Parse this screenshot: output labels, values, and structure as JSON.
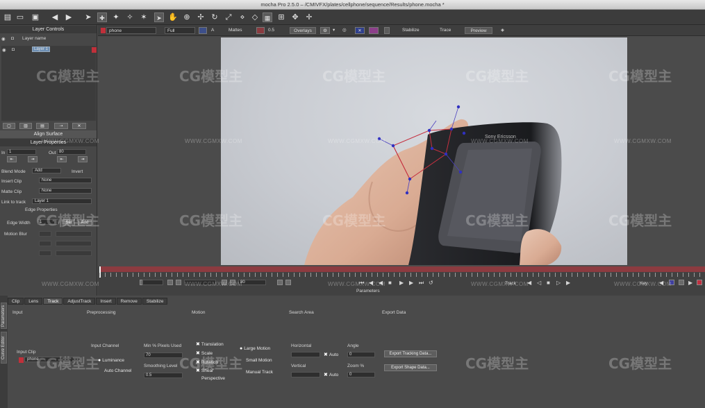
{
  "window": {
    "title": "mocha Pro 2.5.0 – /CMIVFX/plates/cellphone/sequence/Results/phone.mocha *"
  },
  "viewer_bar": {
    "layer_name": "phone",
    "view_mode": "Full",
    "mattes_label": "Mattes",
    "opacity_value": "0.5",
    "overlays_label": "Overlays",
    "stabilize_label": "Stabilize",
    "trace_label": "Trace",
    "preview_label": "Preview"
  },
  "layer_controls": {
    "title": "Layer Controls",
    "column_header": "Layer name",
    "layers": [
      {
        "name": "Layer 1"
      }
    ]
  },
  "align_surface_label": "Align Surface",
  "layer_properties": {
    "title": "Layer Properties",
    "in_label": "In",
    "in_value": "1",
    "out_label": "Out",
    "out_value": "80",
    "blend_mode_label": "Blend Mode",
    "blend_mode_value": "Add",
    "invert_label": "Invert",
    "insert_clip_label": "Insert Clip",
    "insert_clip_value": "None",
    "matte_clip_label": "Matte Clip",
    "matte_clip_value": "None",
    "link_to_track_label": "Link to track",
    "link_to_track_value": "Layer 1"
  },
  "edge_properties": {
    "title": "Edge Properties",
    "edge_width_label": "Edge Width",
    "edge_width_value": "1",
    "set_label": "Set",
    "add_label": "Add",
    "motion_blur_label": "Motion Blur"
  },
  "timeline": {
    "frame_value": "80",
    "track_label": "Track",
    "key_label": "Key",
    "parameters_label": "Parameters"
  },
  "parameters": {
    "side_tabs": [
      "Parameters",
      "Curve Editor"
    ],
    "tabs": [
      {
        "label": "Clip",
        "active": false
      },
      {
        "label": "Lens",
        "active": false
      },
      {
        "label": "Track",
        "active": true
      },
      {
        "label": "AdjustTrack",
        "active": false
      },
      {
        "label": "Insert",
        "active": false
      },
      {
        "label": "Remove",
        "active": false
      },
      {
        "label": "Stabilize",
        "active": false
      }
    ],
    "sections": {
      "input": "Input",
      "preprocessing": "Preprocessing",
      "motion": "Motion",
      "search_area": "Search Area",
      "export_data": "Export Data"
    },
    "input_clip_label": "Input Clip",
    "input_clip_value": "phone",
    "input_channel_label": "Input Channel",
    "luminance_label": "Luminance",
    "auto_channel_label": "Auto Channel",
    "min_pixels_label": "Min % Pixels Used",
    "min_pixels_value": "70",
    "smoothing_label": "Smoothing Level",
    "smoothing_value": "0.5",
    "motion_options": [
      {
        "label": "Translation",
        "checked": true
      },
      {
        "label": "Scale",
        "checked": true
      },
      {
        "label": "Rotation",
        "checked": true
      },
      {
        "label": "Shear",
        "checked": true
      },
      {
        "label": "Perspective",
        "checked": false
      }
    ],
    "large_motion_label": "Large Motion",
    "small_motion_label": "Small Motion",
    "manual_track_label": "Manual Track",
    "horizontal_label": "Horizontal",
    "vertical_label": "Vertical",
    "auto_label": "Auto",
    "angle_label": "Angle",
    "angle_value": "0",
    "zoom_label": "Zoom %",
    "zoom_value": "0",
    "export_tracking_label": "Export Tracking Data...",
    "export_shape_label": "Export Shape Data..."
  },
  "watermark": {
    "brand": "CG模型主",
    "url": "WWW.CGMXW.COM"
  }
}
